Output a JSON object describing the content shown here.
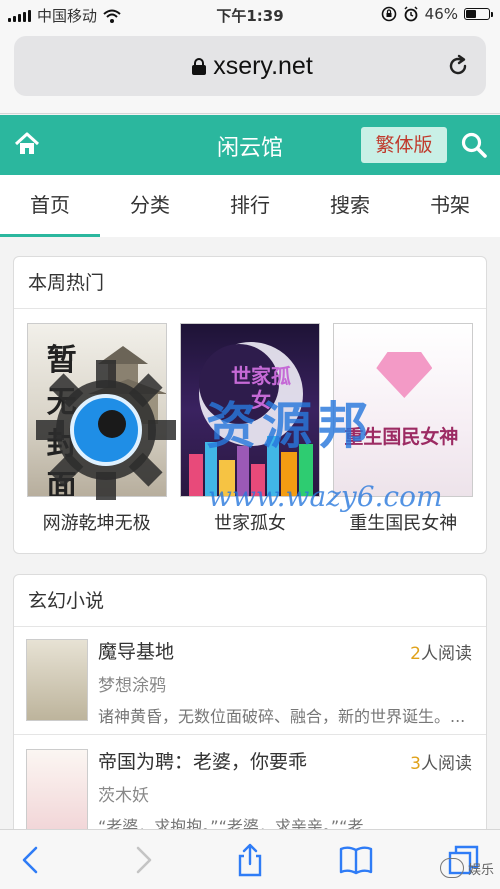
{
  "status_bar": {
    "carrier": "中国移动",
    "time": "下午1:39",
    "battery": "46%",
    "battery_level": 0.46
  },
  "browser": {
    "url": "xsery.net"
  },
  "site": {
    "title": "闲云馆",
    "traditional_button": "繁体版",
    "brand_color": "#2bb79e"
  },
  "nav": {
    "tabs": [
      {
        "label": "首页",
        "active": true
      },
      {
        "label": "分类",
        "active": false
      },
      {
        "label": "排行",
        "active": false
      },
      {
        "label": "搜索",
        "active": false
      },
      {
        "label": "书架",
        "active": false
      }
    ]
  },
  "hot_section": {
    "title": "本周热门",
    "books": [
      {
        "title": "网游乾坤无极",
        "cover_text": "暂无封面"
      },
      {
        "title": "世家孤女",
        "cover_text": "世家孤女"
      },
      {
        "title": "重生国民女神",
        "cover_text": "重生国民女神"
      }
    ]
  },
  "fantasy_section": {
    "title": "玄幻小说",
    "items": [
      {
        "name": "魔导基地",
        "reads_num": "2",
        "reads_suffix": "人阅读",
        "author": "梦想涂鸦",
        "desc": "诸神黄昏，无数位面破碎、融合，新的世界诞生。..."
      },
      {
        "name": "帝国为聘：老婆，你要乖",
        "reads_num": "3",
        "reads_suffix": "人阅读",
        "author": "茨木妖",
        "desc": "“老婆，求抱抱。”“老婆，求亲亲。”“老"
      }
    ]
  },
  "watermark": {
    "text": "资源邦",
    "url": "www.wazy6.com",
    "corner": "娱乐"
  }
}
